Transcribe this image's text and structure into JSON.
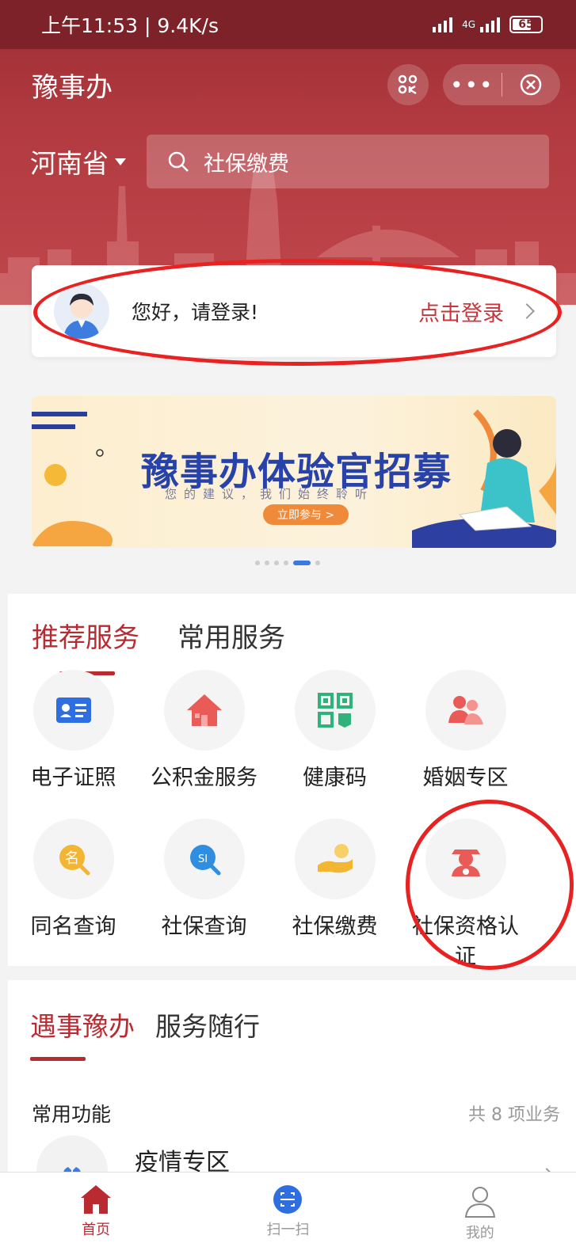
{
  "status_bar": {
    "time_speed": "上午11:53 | 9.4K/s",
    "battery": "65"
  },
  "app": {
    "title": "豫事办"
  },
  "location": {
    "province": "河南省"
  },
  "search": {
    "placeholder": "社保缴费"
  },
  "login": {
    "greeting": "您好，请登录!",
    "action": "点击登录"
  },
  "banner": {
    "title": "豫事办体验官招募",
    "subtitle": "您的建议，我们始终聆听",
    "button": "立即参与 >"
  },
  "services": {
    "tabs": [
      "推荐服务",
      "常用服务"
    ],
    "items": [
      {
        "label": "电子证照",
        "icon": "id-card-icon",
        "color": "#2f6ee0"
      },
      {
        "label": "公积金服务",
        "icon": "house-icon",
        "color": "#ea5a57"
      },
      {
        "label": "健康码",
        "icon": "qr-code-icon",
        "color": "#2eb37a"
      },
      {
        "label": "婚姻专区",
        "icon": "couple-icon",
        "color": "#ea5a57"
      },
      {
        "label": "同名查询",
        "icon": "name-search-icon",
        "color": "#f2b632"
      },
      {
        "label": "社保查询",
        "icon": "social-security-search-icon",
        "color": "#2f8ee0"
      },
      {
        "label": "社保缴费",
        "icon": "payment-hand-icon",
        "color": "#f2b632"
      },
      {
        "label": "社保资格认证",
        "icon": "elder-verify-icon",
        "color": "#ea5a57"
      }
    ]
  },
  "life": {
    "tabs": [
      "遇事豫办",
      "服务随行"
    ],
    "common_label": "常用功能",
    "count": "共 8 项业务",
    "first_item": "疫情专区"
  },
  "bottom_nav": [
    {
      "label": "首页",
      "icon": "home-icon"
    },
    {
      "label": "扫一扫",
      "icon": "scan-icon"
    },
    {
      "label": "我的",
      "icon": "person-icon"
    }
  ],
  "colors": {
    "brand_red": "#b92a31",
    "annotation_red": "#e82121"
  }
}
